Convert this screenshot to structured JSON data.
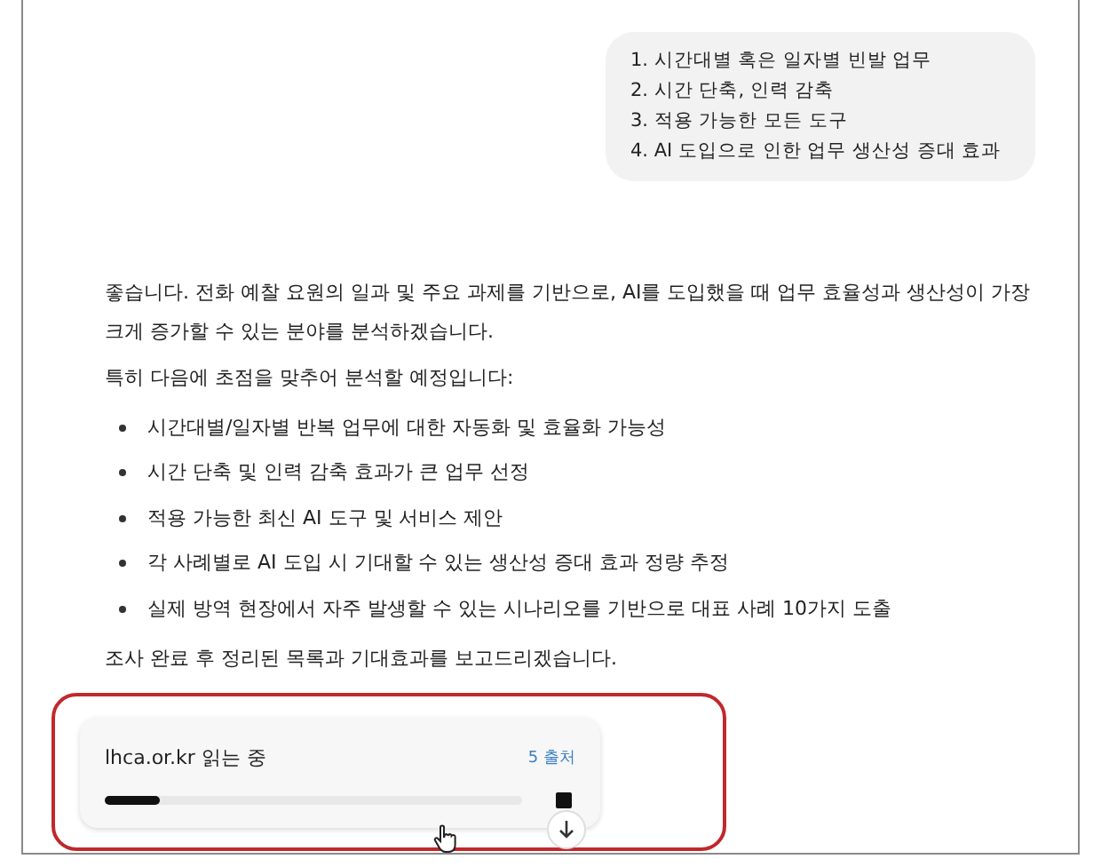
{
  "user_message": {
    "lines": [
      "1. 시간대별 혹은 일자별 빈발 업무",
      "2. 시간 단축, 인력 감축",
      "3. 적용 가능한 모든 도구",
      "4. AI 도입으로 인한 업무 생산성 증대 효과"
    ]
  },
  "response": {
    "intro": "좋습니다. 전화 예찰 요원의 일과 및 주요 과제를 기반으로, AI를 도입했을 때 업무 효율성과 생산성이 가장 크게 증가할 수 있는 분야를 분석하겠습니다.",
    "focus_label": "특히 다음에 초점을 맞추어 분석할 예정입니다:",
    "bullets": [
      "시간대별/일자별 반복 업무에 대한 자동화 및 효율화 가능성",
      "시간 단축 및 인력 감축 효과가 큰 업무 선정",
      "적용 가능한 최신 AI 도구 및 서비스 제안",
      "각 사례별로 AI 도입 시 기대할 수 있는 생산성 증대 효과 정량 추정",
      "실제 방역 현장에서 자주 발생할 수 있는 시나리오를 기반으로 대표 사례 10가지 도출"
    ],
    "closing": "조사 완료 후 정리된 목록과 기대효과를 보고드리겠습니다."
  },
  "research_card": {
    "status": "lhca.or.kr 읽는 중",
    "sources": "5 출처",
    "level": 0.13,
    "highlighted": true
  }
}
